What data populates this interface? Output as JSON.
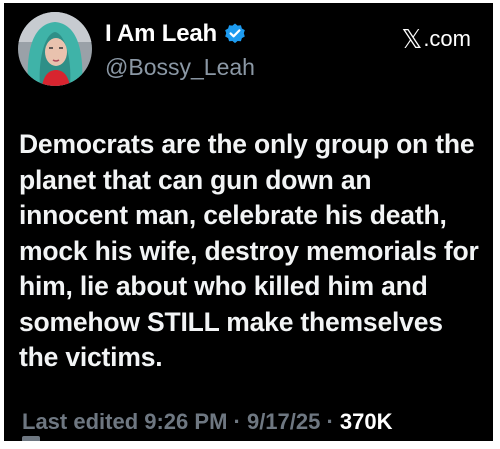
{
  "author": {
    "display_name": "I Am Leah",
    "handle": "@Bossy_Leah",
    "verified": true,
    "avatar": "profile-photo"
  },
  "brand": {
    "x_glyph": "𝕏",
    "label": ".com"
  },
  "tweet": {
    "text": "Democrats are the only group on the planet that can gun down an innocent man, celebrate his death, mock his wife, destroy memorials for him, lie about who killed him and somehow STILL make themselves the victims."
  },
  "meta": {
    "edited_label": "Last edited 9:26 PM",
    "sep1": " · ",
    "date": "9/17/25",
    "sep2": " · ",
    "views": "370K"
  },
  "colors": {
    "background": "#000000",
    "verified_badge": "#1d9bf0",
    "muted": "#6e7781"
  }
}
